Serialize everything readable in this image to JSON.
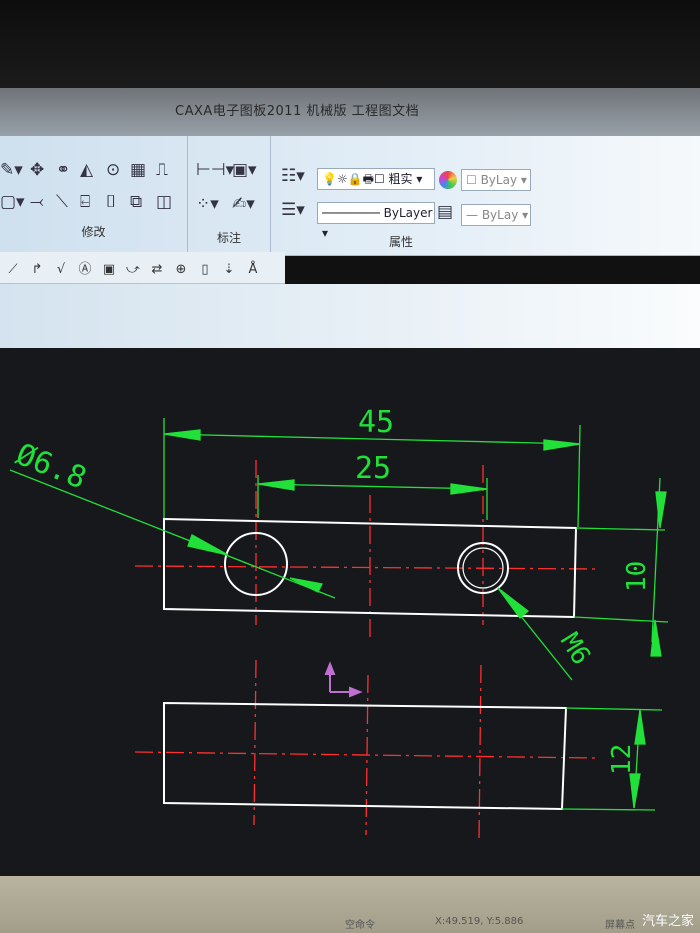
{
  "window": {
    "title": "CAXA电子图板2011 机械版 工程图文档"
  },
  "ribbon": {
    "groups": [
      {
        "label": "修改"
      },
      {
        "label": "标注"
      },
      {
        "label": "属性"
      }
    ],
    "layer_linetype": "粗实",
    "color_value": "ByLay",
    "linetype_value": "ByLayer",
    "lineweight_value": "ByLay"
  },
  "drawing": {
    "dim_total": "45",
    "dim_hole_spacing": "25",
    "dim_diameter": "Ø6.8",
    "dim_height_top": "10",
    "dim_thread": "M6",
    "dim_height_bottom": "12",
    "colors": {
      "outline": "#ffffff",
      "dimension": "#22e03a",
      "centerline": "#ff3030",
      "ucs": "#c070d0"
    }
  },
  "status": {
    "command": "空命令",
    "coords": "X:49.519, Y:5.886",
    "mode": "屏幕点"
  },
  "watermark": "汽车之家"
}
